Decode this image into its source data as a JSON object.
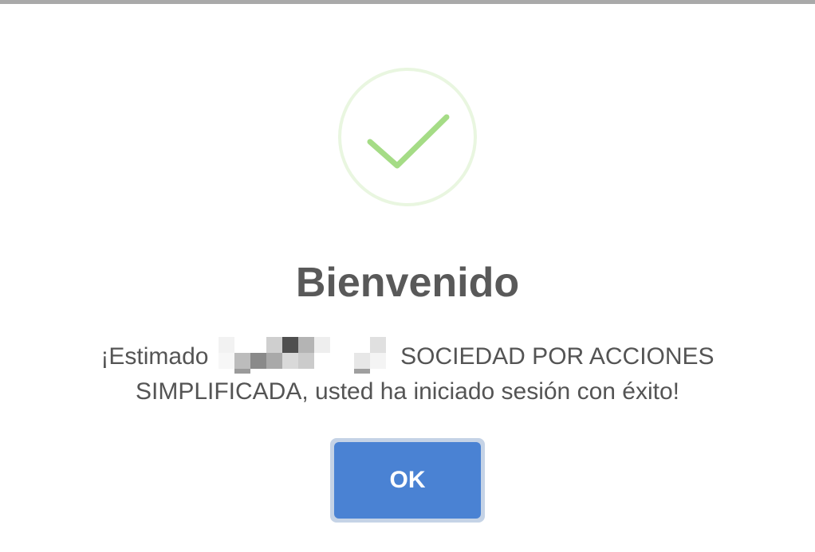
{
  "dialog": {
    "icon": "success-checkmark-icon",
    "title": "Bienvenido",
    "message_before": "¡Estimado",
    "message_after": "SOCIEDAD POR ACCIONES SIMPLIFICADA, usted ha iniciado sesión con éxito!",
    "ok_label": "OK"
  },
  "colors": {
    "success_green": "#a5dc86",
    "success_ring": "#e9f6e0",
    "button_blue": "#4a82d3",
    "button_focus_ring": "#c5d3e6",
    "title_text": "#595959",
    "body_text": "#545454"
  }
}
